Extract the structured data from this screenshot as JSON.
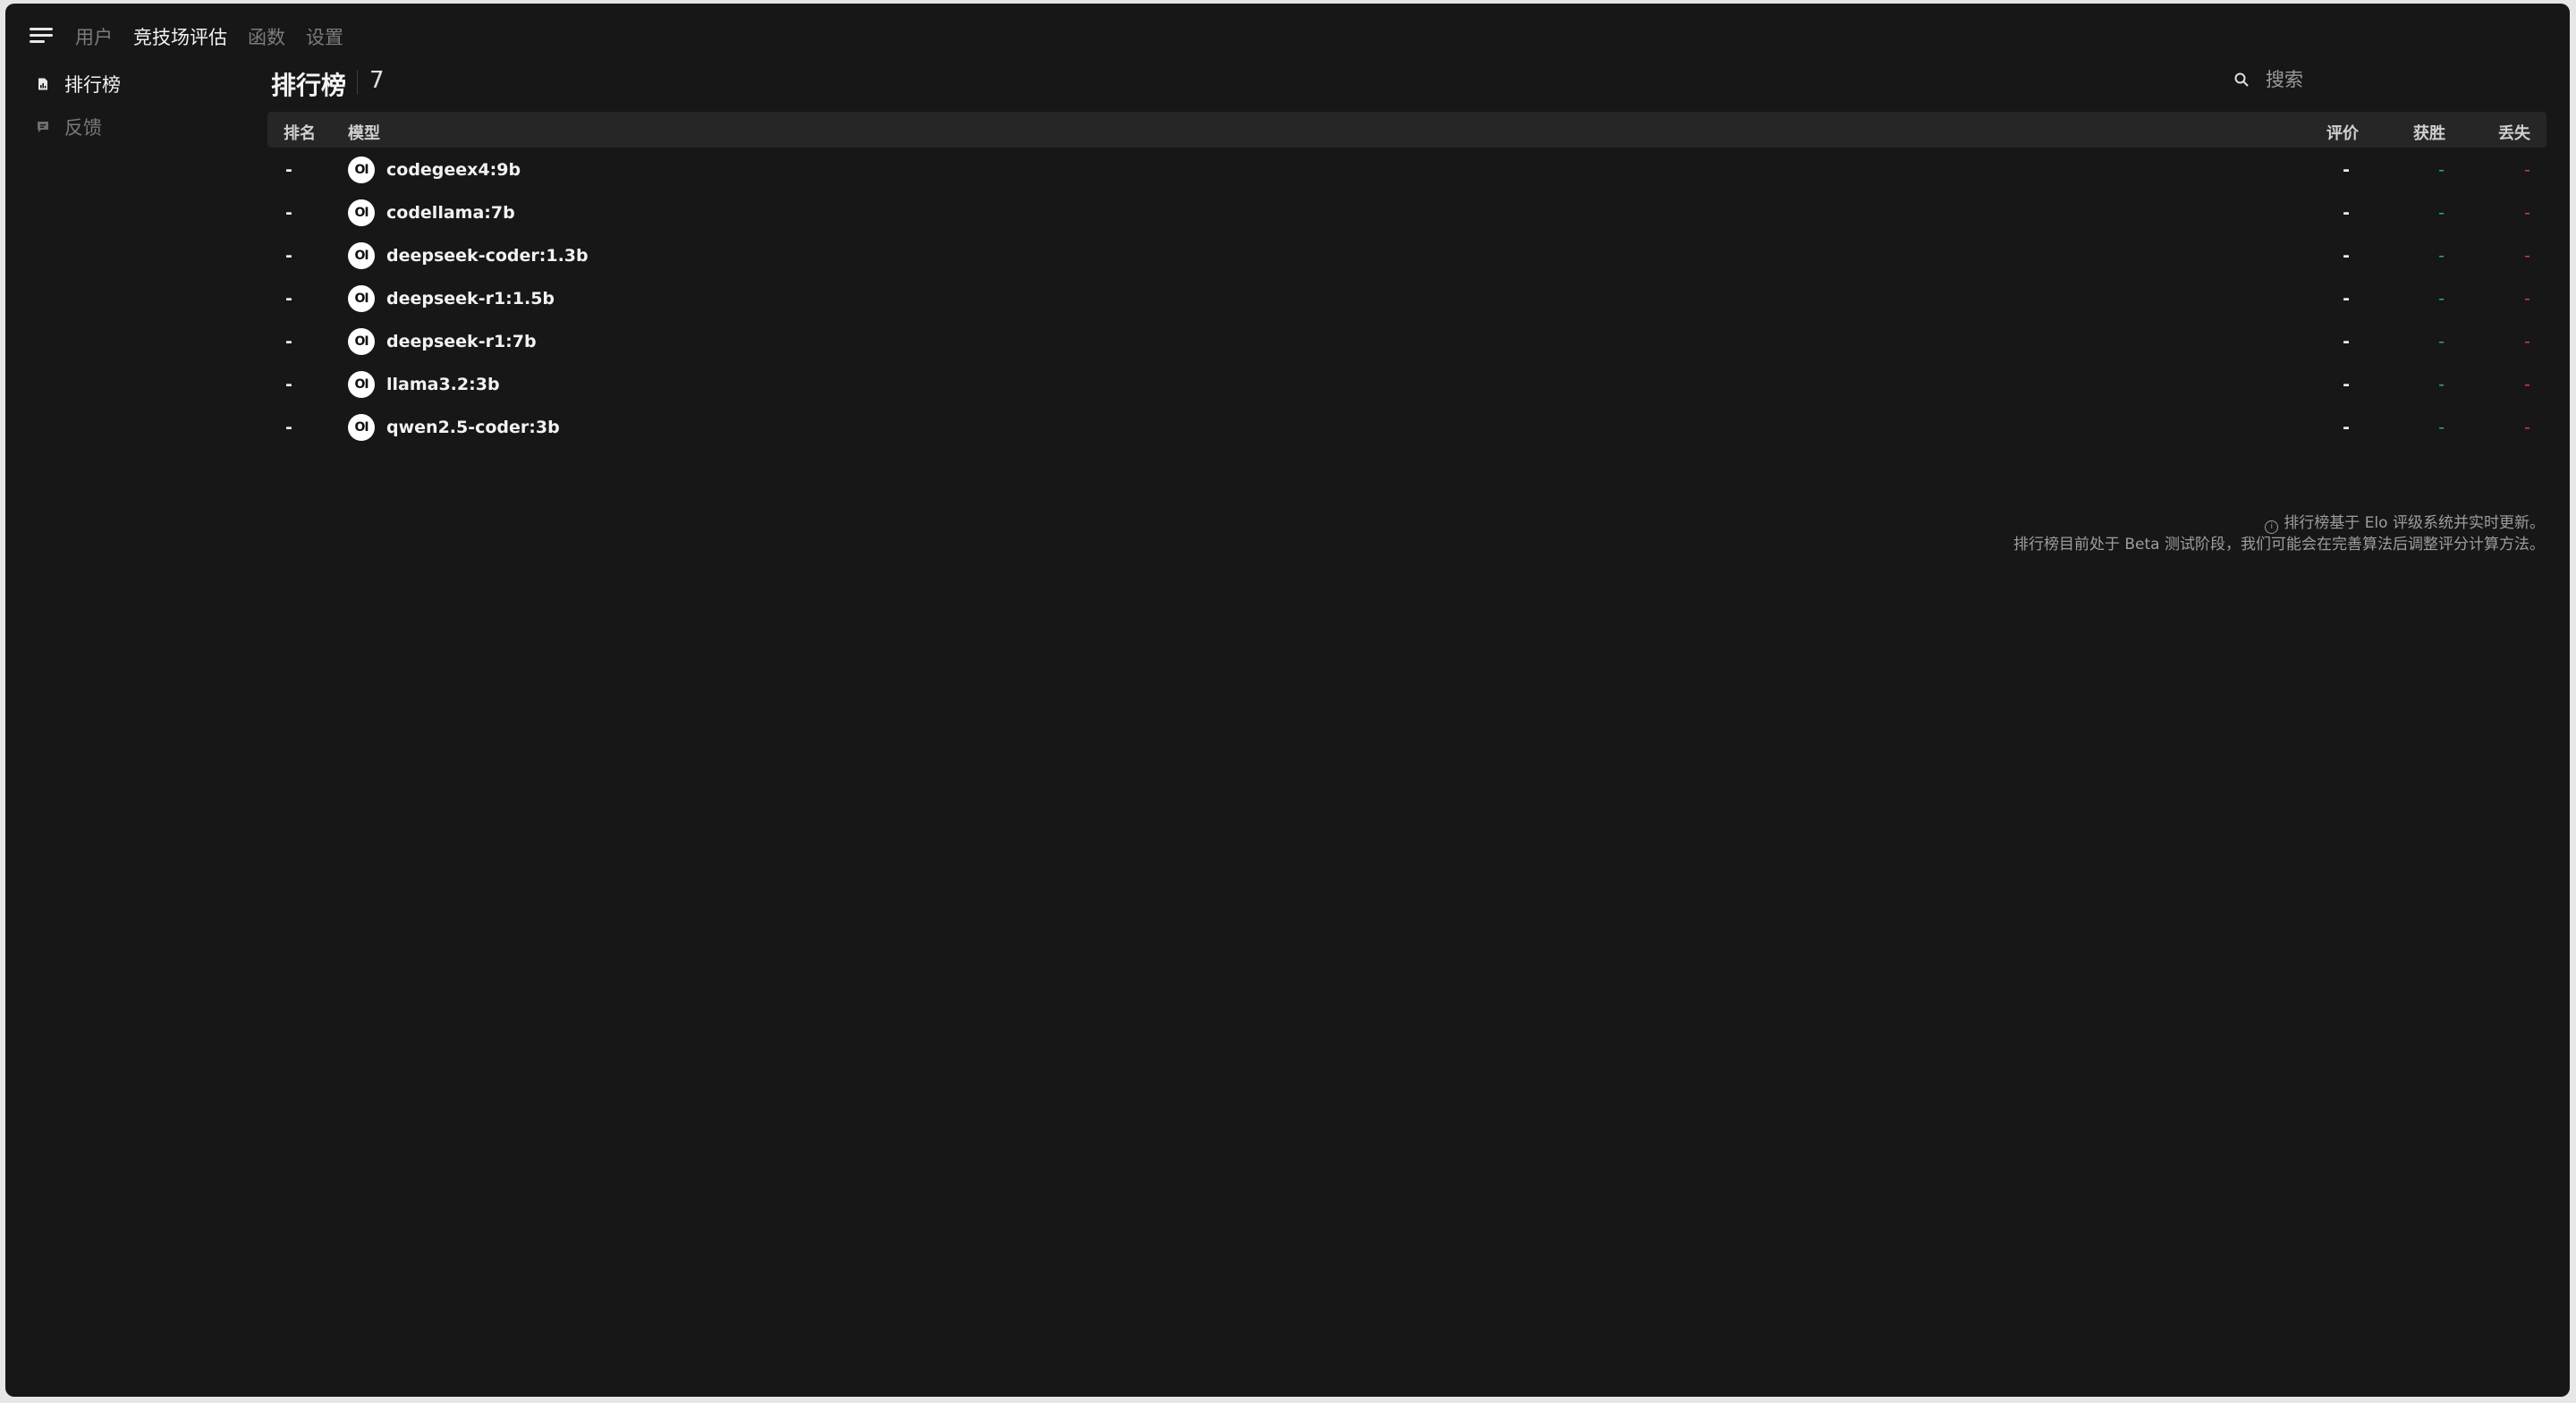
{
  "nav": {
    "tabs": [
      {
        "label": "用户",
        "active": false
      },
      {
        "label": "竞技场评估",
        "active": true
      },
      {
        "label": "函数",
        "active": false
      },
      {
        "label": "设置",
        "active": false
      }
    ]
  },
  "sidebar": {
    "items": [
      {
        "label": "排行榜",
        "icon": "document-chart-icon",
        "active": true
      },
      {
        "label": "反馈",
        "icon": "chat-bubble-icon",
        "active": false
      }
    ]
  },
  "leaderboard": {
    "title": "排行榜",
    "count": "7",
    "search_placeholder": "搜索",
    "columns": {
      "rank": "排名",
      "model": "模型",
      "rating": "评价",
      "won": "获胜",
      "lost": "丢失"
    },
    "rows": [
      {
        "rank": "-",
        "avatar": "OI",
        "model": "codegeex4:9b",
        "rating": "-",
        "won": "-",
        "lost": "-"
      },
      {
        "rank": "-",
        "avatar": "OI",
        "model": "codellama:7b",
        "rating": "-",
        "won": "-",
        "lost": "-"
      },
      {
        "rank": "-",
        "avatar": "OI",
        "model": "deepseek-coder:1.3b",
        "rating": "-",
        "won": "-",
        "lost": "-"
      },
      {
        "rank": "-",
        "avatar": "OI",
        "model": "deepseek-r1:1.5b",
        "rating": "-",
        "won": "-",
        "lost": "-"
      },
      {
        "rank": "-",
        "avatar": "OI",
        "model": "deepseek-r1:7b",
        "rating": "-",
        "won": "-",
        "lost": "-"
      },
      {
        "rank": "-",
        "avatar": "OI",
        "model": "llama3.2:3b",
        "rating": "-",
        "won": "-",
        "lost": "-"
      },
      {
        "rank": "-",
        "avatar": "OI",
        "model": "qwen2.5-coder:3b",
        "rating": "-",
        "won": "-",
        "lost": "-"
      }
    ],
    "footnote_line1": "排行榜基于 Elo 评级系统并实时更新。",
    "footnote_line2": "排行榜目前处于 Beta 测试阶段，我们可能会在完善算法后调整评分计算方法。"
  },
  "colors": {
    "background": "#171717",
    "won": "#28b463",
    "lost": "#e0334a"
  }
}
